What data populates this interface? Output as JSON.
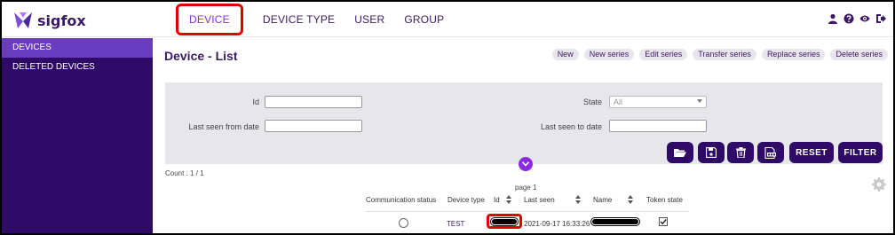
{
  "brand": {
    "name": "sigfox",
    "logo_icon": "sigfox-logo-icon"
  },
  "nav": {
    "items": [
      {
        "label": "DEVICE",
        "active": true
      },
      {
        "label": "DEVICE TYPE",
        "active": false
      },
      {
        "label": "USER",
        "active": false
      },
      {
        "label": "GROUP",
        "active": false
      }
    ]
  },
  "header_icons": [
    "user-icon",
    "help-icon",
    "eye-icon",
    "logout-icon"
  ],
  "sidebar": {
    "items": [
      {
        "label": "DEVICES",
        "active": true
      },
      {
        "label": "DELETED DEVICES",
        "active": false
      }
    ]
  },
  "page": {
    "title": "Device - List"
  },
  "actions": [
    "New",
    "New series",
    "Edit series",
    "Transfer series",
    "Replace series",
    "Delete series"
  ],
  "filters": {
    "id_label": "Id",
    "state_label": "State",
    "state_value": "All",
    "last_seen_from_label": "Last seen from date",
    "last_seen_to_label": "Last seen to date"
  },
  "toolbar": {
    "icons": [
      "folder-open-icon",
      "save-icon",
      "trash-icon",
      "csv-export-icon"
    ],
    "reset_label": "RESET",
    "filter_label": "FILTER"
  },
  "results": {
    "count": "Count : 1 / 1",
    "page": "page 1"
  },
  "table": {
    "headers": [
      "Communication status",
      "Device type",
      "Id",
      "Last seen",
      "Name",
      "Token state"
    ],
    "rows": [
      {
        "device_type": "TEST",
        "last_seen": "2021-09-17 16:33:26"
      }
    ]
  },
  "colors": {
    "primary": "#2f0a66",
    "sidebar_active": "#6a3cbf",
    "accent": "#8a2be2",
    "highlight": "#e00000",
    "panel": "#e7e6ea"
  }
}
